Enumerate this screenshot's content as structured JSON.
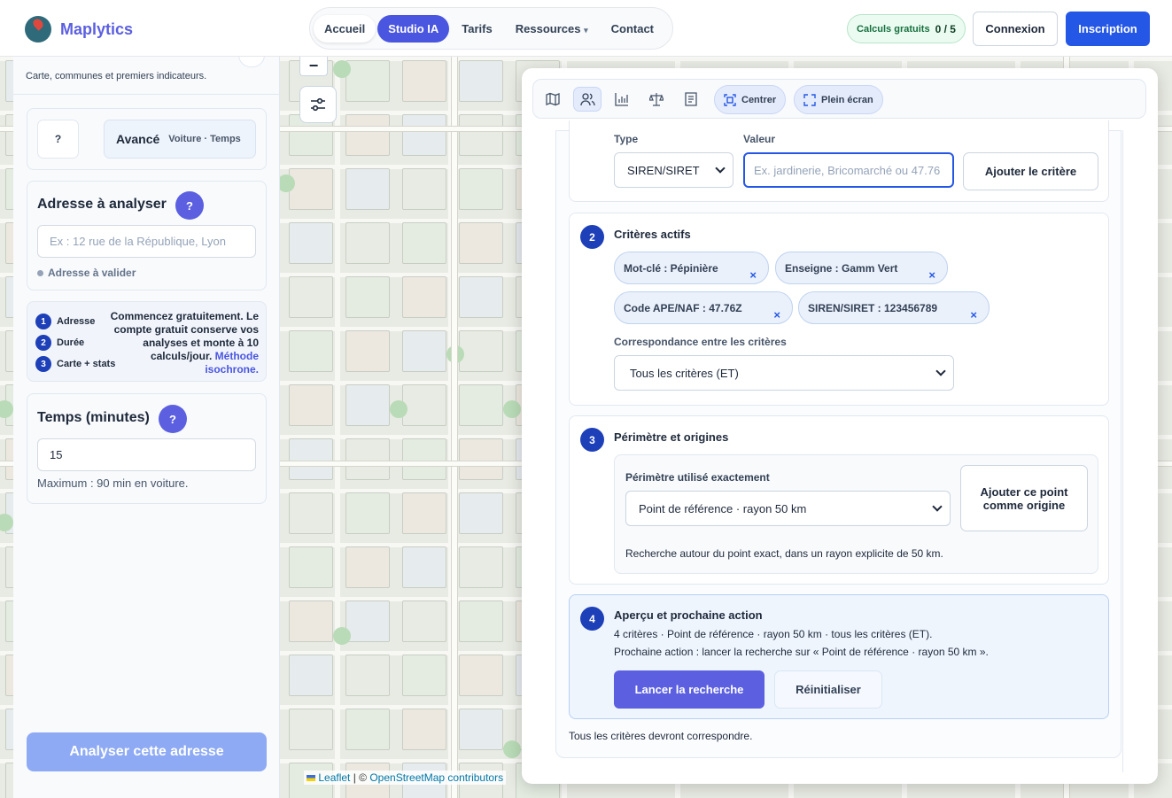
{
  "brand": {
    "name": "Maplytics"
  },
  "nav": {
    "items": [
      {
        "label": "Accueil"
      },
      {
        "label": "Studio IA"
      },
      {
        "label": "Tarifs"
      },
      {
        "label": "Ressources"
      },
      {
        "label": "Contact"
      }
    ],
    "dropdown_caret": "▾"
  },
  "quota": {
    "label": "Calculs gratuits",
    "value": "0 / 5"
  },
  "auth": {
    "login": "Connexion",
    "signup": "Inscription"
  },
  "sidebar": {
    "subtitle": "Carte, communes et premiers indicateurs.",
    "mode": {
      "help": "?",
      "label": "Avancé",
      "detail": "Voiture · Temps"
    },
    "address": {
      "title": "Adresse à analyser",
      "help": "?",
      "placeholder": "Ex : 12 rue de la République, Lyon",
      "status": "Adresse à valider"
    },
    "steps": [
      {
        "n": "1",
        "label": "Adresse"
      },
      {
        "n": "2",
        "label": "Durée"
      },
      {
        "n": "3",
        "label": "Carte + stats"
      }
    ],
    "promo": {
      "text": "Commencez gratuitement. Le compte gratuit conserve vos analyses et monte à 10 calculs/jour.",
      "link": "Méthode isochrone."
    },
    "time": {
      "title": "Temps (minutes)",
      "help": "?",
      "value": "15",
      "note": "Maximum : 90 min en voiture."
    },
    "analyze_button": "Analyser cette adresse"
  },
  "map": {
    "zoom_out": "−",
    "attribution": {
      "leaflet": "Leaflet",
      "sep": " | © ",
      "osm": "OpenStreetMap contributors"
    }
  },
  "panel": {
    "toolbar": {
      "icons": [
        "map-icon",
        "users-icon",
        "bar-chart-icon",
        "scale-icon",
        "document-icon"
      ],
      "center": "Centrer",
      "fullscreen": "Plein écran"
    },
    "criteria_form": {
      "type_label": "Type",
      "type_value": "SIREN/SIRET",
      "value_label": "Valeur",
      "value_placeholder": "Ex. jardinerie, Bricomarché ou 47.76",
      "add_button": "Ajouter le critère"
    },
    "active": {
      "num": "2",
      "title": "Critères actifs",
      "chips": [
        {
          "label": "Mot-clé : Pépinière"
        },
        {
          "label": "Enseigne : Gamm Vert"
        },
        {
          "label": "Code APE/NAF : 47.76Z"
        },
        {
          "label": "SIREN/SIRET : 123456789"
        }
      ],
      "remove": "×",
      "match_label": "Correspondance entre les critères",
      "match_value": "Tous les critères (ET)"
    },
    "perimeter": {
      "num": "3",
      "title": "Périmètre et origines",
      "used_label": "Périmètre utilisé exactement",
      "used_value": "Point de référence · rayon 50 km",
      "add_origin": "Ajouter ce point comme origine",
      "description": "Recherche autour du point exact, dans un rayon explicite de 50 km."
    },
    "preview": {
      "num": "4",
      "title": "Aperçu et prochaine action",
      "summary": "4 critères · Point de référence · rayon 50 km · tous les critères (ET).",
      "next": "Prochaine action : lancer la recherche sur « Point de référence · rayon 50 km ».",
      "launch": "Lancer la recherche",
      "reset": "Réinitialiser"
    },
    "footer_note": "Tous les critères devront correspondre."
  }
}
